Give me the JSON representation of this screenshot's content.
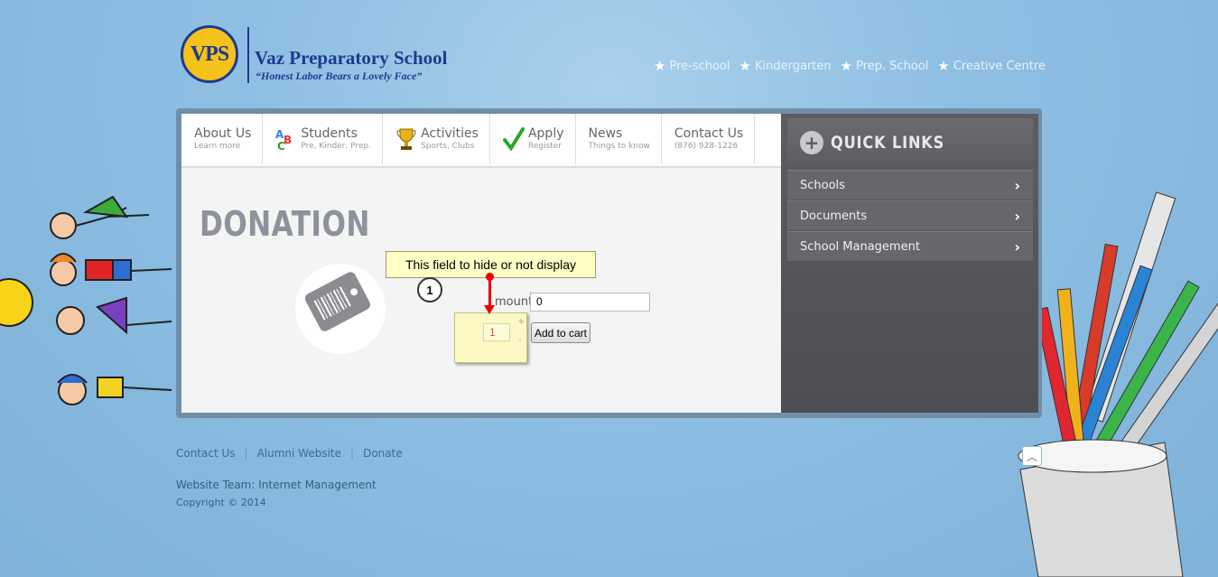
{
  "logo": {
    "badge_text": "VPS",
    "name": "Vaz Preparatory School",
    "motto": "“Honest Labor Bears a Lovely Face”"
  },
  "topnav": [
    "Pre-school",
    "Kindergarten",
    "Prep. School",
    "Creative Centre"
  ],
  "menu": [
    {
      "title": "About Us",
      "sub": "Learn more",
      "icon": "none"
    },
    {
      "title": "Students",
      "sub": "Pre, Kinder, Prep.",
      "icon": "abc-blocks-icon"
    },
    {
      "title": "Activities",
      "sub": "Sports, Clubs",
      "icon": "trophy-icon"
    },
    {
      "title": "Apply",
      "sub": "Register",
      "icon": "checkmark-icon"
    },
    {
      "title": "News",
      "sub": "Things to know",
      "icon": "none"
    },
    {
      "title": "Contact Us",
      "sub": "(876) 928-1226",
      "icon": "none"
    }
  ],
  "page": {
    "title": "DONATION"
  },
  "form": {
    "amount_label": "mount",
    "amount_value": "0",
    "quantity_value": "1",
    "plus": "+",
    "minus": "-",
    "add_to_cart": "Add to cart"
  },
  "annotation": {
    "callout": "This field to hide or not display",
    "step": "1"
  },
  "quick_links": {
    "title": "QUICK LINKS",
    "items": [
      "Schools",
      "Documents",
      "School Management"
    ]
  },
  "footer": {
    "links": [
      "Contact Us",
      "Alumni Website",
      "Donate"
    ],
    "team": "Website Team: Internet Management",
    "copyright": "Copyright © 2014"
  },
  "colors": {
    "logo_blue": "#1d3a8f",
    "logo_gold": "#f4c21a",
    "annotation_red": "#e00000",
    "callout_bg": "#ffffc6"
  }
}
